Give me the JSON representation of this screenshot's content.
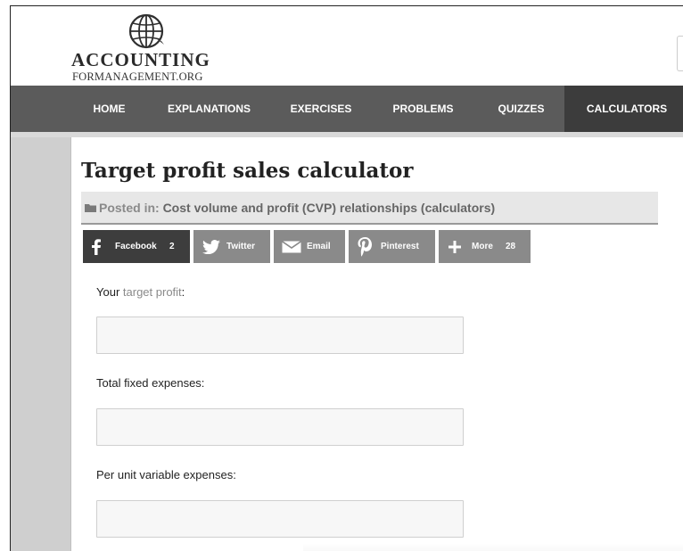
{
  "logo": {
    "main": "ACCOUNTING",
    "sub": "FORMANAGEMENT.ORG"
  },
  "nav": [
    {
      "label": "HOME"
    },
    {
      "label": "EXPLANATIONS"
    },
    {
      "label": "EXERCISES"
    },
    {
      "label": "PROBLEMS"
    },
    {
      "label": "QUIZZES"
    },
    {
      "label": "CALCULATORS",
      "active": true
    }
  ],
  "page": {
    "title": "Target profit sales calculator",
    "posted_prefix": "Posted in:",
    "posted_category": "Cost volume and profit (CVP) relationships (calculators)"
  },
  "share": [
    {
      "label": "Facebook",
      "count": "2",
      "icon": "facebook-icon"
    },
    {
      "label": "Twitter",
      "count": "",
      "icon": "twitter-icon"
    },
    {
      "label": "Email",
      "count": "",
      "icon": "email-icon"
    },
    {
      "label": "Pinterest",
      "count": "",
      "icon": "pinterest-icon"
    },
    {
      "label": "More",
      "count": "28",
      "icon": "plus-icon"
    }
  ],
  "form": {
    "target_profit_label_pre": "Your",
    "target_profit_label_link": "target profit",
    "target_profit_label_post": ":",
    "target_profit_value": "",
    "fixed_expenses_label": "Total fixed expenses:",
    "fixed_expenses_value": "",
    "variable_expenses_label": "Per unit variable expenses:",
    "variable_expenses_value": ""
  },
  "colors": {
    "nav_bg": "#5b5b5b",
    "nav_active_bg": "#3c3c3c",
    "share_facebook": "#3d3d3d",
    "share_other": "#8a8a8a",
    "sidebar": "#cfcfcf"
  }
}
